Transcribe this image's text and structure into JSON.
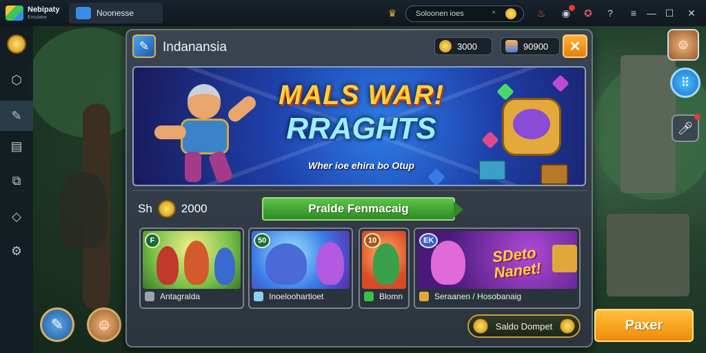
{
  "titlebar": {
    "brand_name": "Nebipaty",
    "brand_sub": "Emulator",
    "tab_label": "Noonesse",
    "search_text": "Soloonen ioes",
    "search_clear": "×",
    "icons": [
      "crown-icon",
      "fire-icon",
      "bell-icon",
      "controller-icon",
      "help-icon",
      "menu-icon",
      "minimize-icon",
      "maximize-icon",
      "close-icon"
    ]
  },
  "sidebar": {
    "items": [
      {
        "name": "coin",
        "icon": "coin-icon"
      },
      {
        "name": "shield",
        "icon": "shield-icon",
        "glyph": "⬡"
      },
      {
        "name": "edit",
        "icon": "edit-icon",
        "glyph": "✎"
      },
      {
        "name": "document",
        "icon": "document-icon",
        "glyph": "▤"
      },
      {
        "name": "apk",
        "icon": "apk-icon",
        "glyph": "⧉"
      },
      {
        "name": "eraser",
        "icon": "eraser-icon",
        "glyph": "◇"
      },
      {
        "name": "settings",
        "icon": "gear-icon",
        "glyph": "⚙"
      }
    ]
  },
  "panel": {
    "title": "Indanansia",
    "coins": "3000",
    "gems": "90900",
    "close_label": "✕"
  },
  "banner": {
    "title_line1": "MALS WAR!",
    "title_line2": "RRAGHTS",
    "subtitle": "Wher ioe ehira bo Otup"
  },
  "reward": {
    "label": "Sh",
    "value": "2000",
    "event_label": "Pralde Fenmacaig"
  },
  "cards": [
    {
      "badge": "F",
      "footer": "Antagralda"
    },
    {
      "badge": "50",
      "footer": "Inoeloohartioet"
    },
    {
      "badge": "10",
      "footer": "Blomn"
    },
    {
      "badge": "EK",
      "footer": "Seraanen / Hosobanaig",
      "promo_text": "SDeto Nanet!"
    }
  ],
  "slide_button": "Saldo Dompet",
  "play_button": "Paxer",
  "colors": {
    "accent_orange": "#ef8a0c",
    "accent_green": "#2f8a24",
    "panel_bg": "#2c343e",
    "banner_blue": "#1e3fa8"
  }
}
